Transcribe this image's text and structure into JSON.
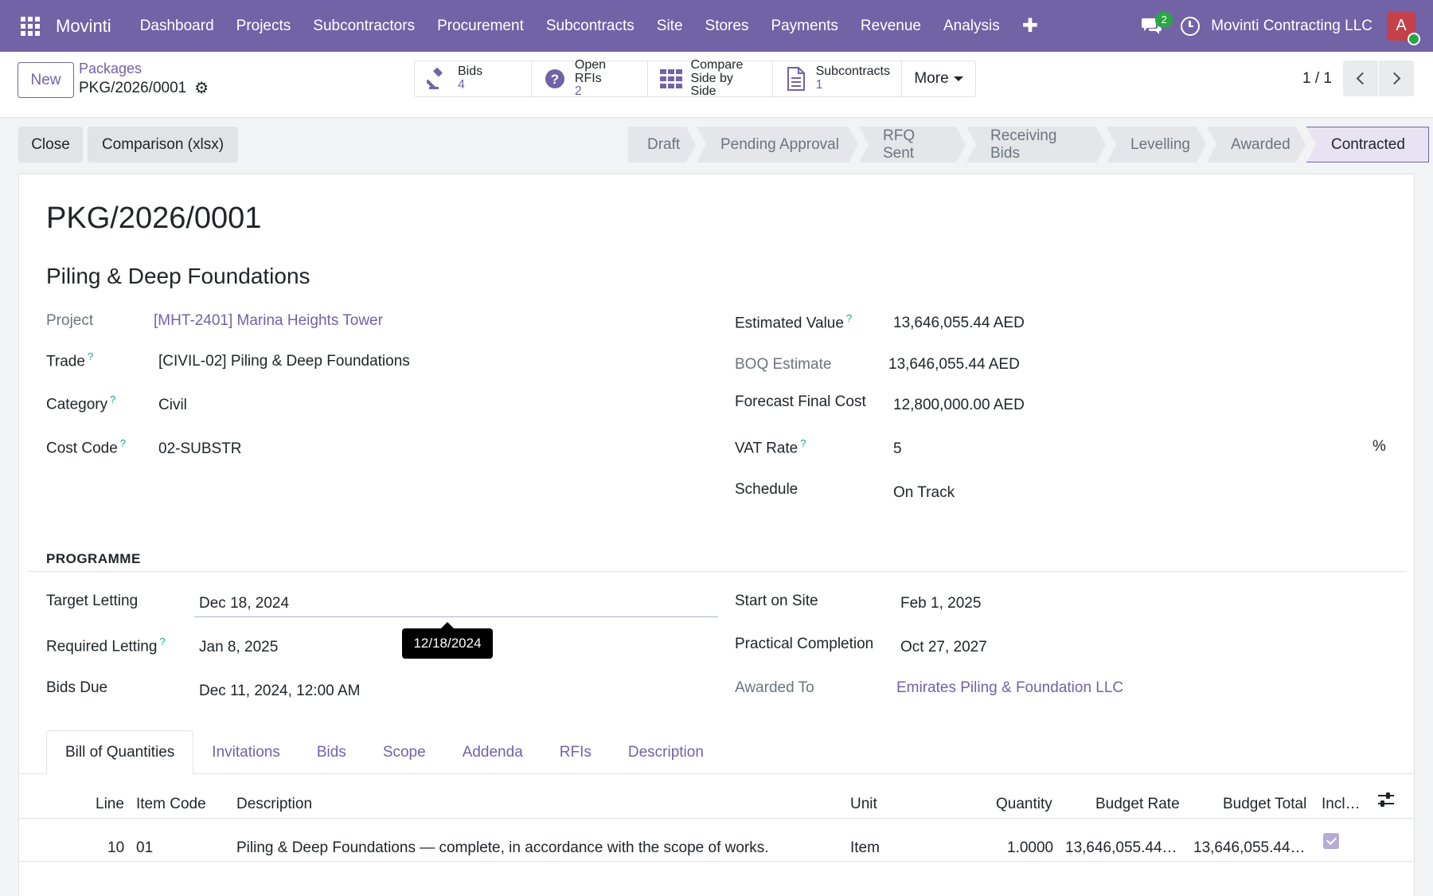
{
  "navbar": {
    "brand": "Movinti",
    "menu": [
      "Dashboard",
      "Projects",
      "Subcontractors",
      "Procurement",
      "Subcontracts",
      "Site",
      "Stores",
      "Payments",
      "Revenue",
      "Analysis"
    ],
    "plus": "✚",
    "chat_badge": "2",
    "company": "Movinti Contracting LLC",
    "avatar_initial": "A",
    "icons": {
      "apps": "apps-grid-icon",
      "chat": "chat-icon",
      "activity": "clock-icon"
    }
  },
  "control": {
    "new_label": "New",
    "breadcrumb_parent": "Packages",
    "breadcrumb_current": "PKG/2026/0001",
    "smart_buttons": [
      {
        "label": "Bids",
        "value": "4",
        "icon": "gavel-icon"
      },
      {
        "label": "Open RFIs",
        "value": "2",
        "icon": "question-circle-icon"
      },
      {
        "label": "Compare",
        "value": "Side by Side",
        "icon": "grid-icon"
      },
      {
        "label": "Subcontracts",
        "value": "1",
        "icon": "document-icon"
      }
    ],
    "more_label": "More",
    "pager": "1 / 1"
  },
  "actions": {
    "close_label": "Close",
    "comparison_label": "Comparison (xlsx)"
  },
  "statusbar": {
    "stages": [
      "Draft",
      "Pending Approval",
      "RFQ Sent",
      "Receiving Bids",
      "Levelling",
      "Awarded",
      "Contracted"
    ],
    "current": "Contracted"
  },
  "form": {
    "title": "PKG/2026/0001",
    "name": "Piling & Deep Foundations",
    "project_label": "Project",
    "project_value": "[MHT-2401] Marina Heights Tower",
    "trade_label": "Trade",
    "trade_value": "[CIVIL-02] Piling & Deep Foundations",
    "category_label": "Category",
    "category_value": "Civil",
    "cost_code_label": "Cost Code",
    "cost_code_value": "02-SUBSTR",
    "estimated_value_label": "Estimated Value",
    "estimated_value": "13,646,055.44 AED",
    "boq_estimate_label": "BOQ Estimate",
    "boq_estimate_value": "13,646,055.44 AED",
    "forecast_label": "Forecast Final Cost",
    "forecast_value": "12,800,000.00 AED",
    "vat_label": "VAT Rate",
    "vat_value": "5",
    "vat_unit": "%",
    "schedule_label": "Schedule",
    "schedule_value": "On Track",
    "help_mark": "?"
  },
  "programme": {
    "section_title": "PROGRAMME",
    "target_letting_label": "Target Letting",
    "target_letting_value": "Dec 18, 2024",
    "tooltip": "12/18/2024",
    "required_letting_label": "Required Letting",
    "required_letting_value": "Jan 8, 2025",
    "bids_due_label": "Bids Due",
    "bids_due_value": "Dec 11, 2024, 12:00 AM",
    "start_on_site_label": "Start on Site",
    "start_on_site_value": "Feb 1, 2025",
    "practical_completion_label": "Practical Completion",
    "practical_completion_value": "Oct 27, 2027",
    "awarded_to_label": "Awarded To",
    "awarded_to_value": "Emirates Piling & Foundation LLC"
  },
  "tabs": [
    "Bill of Quantities",
    "Invitations",
    "Bids",
    "Scope",
    "Addenda",
    "RFIs",
    "Description"
  ],
  "active_tab": "Bill of Quantities",
  "boq_table": {
    "headers": {
      "line": "Line",
      "item_code": "Item Code",
      "description": "Description",
      "unit": "Unit",
      "quantity": "Quantity",
      "budget_rate": "Budget Rate",
      "budget_total": "Budget Total",
      "included": "Incl…"
    },
    "rows": [
      {
        "line": "10",
        "item_code": "01",
        "description": "Piling & Deep Foundations — complete, in accordance with the scope of works.",
        "unit": "Item",
        "quantity": "1.0000",
        "budget_rate": "13,646,055.44…",
        "budget_total": "13,646,055.44…",
        "included": true
      }
    ]
  },
  "colors": {
    "brand": "#7262a6",
    "navbar": "#7262a6",
    "badge": "#28a745",
    "help": "#17a589",
    "avatar": "#c2414b"
  }
}
